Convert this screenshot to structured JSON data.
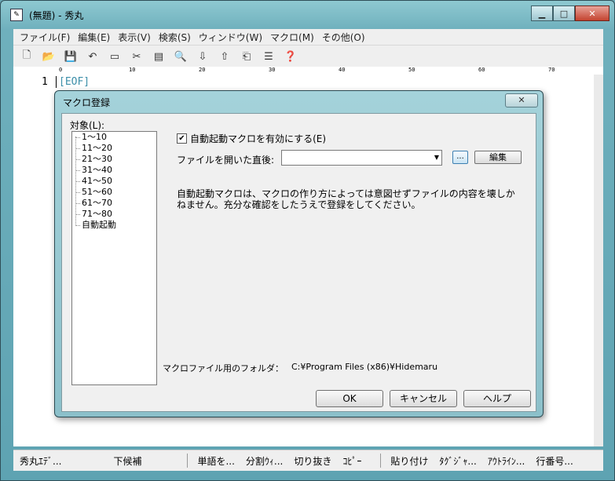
{
  "window": {
    "title": "(無題) - 秀丸",
    "minimize": "▁",
    "maximize": "□",
    "close": "✕"
  },
  "menu": [
    "ファイル(F)",
    "編集(E)",
    "表示(V)",
    "検索(S)",
    "ウィンドウ(W)",
    "マクロ(M)",
    "その他(O)"
  ],
  "toolbar_icons": [
    "new-file-icon",
    "open-folder-icon",
    "save-icon",
    "undo-icon",
    "copy-rect-icon",
    "cut-icon",
    "paste-icon",
    "search-icon",
    "search-down-icon",
    "search-up-icon",
    "tag-jump-icon",
    "split-window-icon",
    "help-icon"
  ],
  "ruler": {
    "marks": [
      "0",
      "10",
      "20",
      "30",
      "40",
      "50",
      "60",
      "70"
    ]
  },
  "editor": {
    "line_number": "1",
    "eof_marker": "[EOF]"
  },
  "status": [
    "秀丸ｴﾃﾞ...",
    "下候補",
    "単語を...",
    "分割ｳｨ...",
    "切り抜き",
    "ｺﾋﾟｰ",
    "貼り付け",
    "ﾀｸﾞｼﾞｬ...",
    "ｱｳﾄﾗｲﾝ...",
    "行番号..."
  ],
  "dialog": {
    "title": "マクロ登録",
    "close": "✕",
    "target_label": "対象(L):",
    "tree": [
      "1～10",
      "11～20",
      "21～30",
      "31～40",
      "41～50",
      "51～60",
      "61～70",
      "71～80",
      "自動起動"
    ],
    "checkbox_label": "自動起動マクロを有効にする(E)",
    "checkbox_checked": true,
    "open_label": "ファイルを開いた直後:",
    "combo_value": "",
    "dots_button": "...",
    "edit_button": "編集",
    "warning": "自動起動マクロは、マクロの作り方によっては意図せずファイルの内容を壊しかねません。充分な確認をしたうえで登録をしてください。",
    "folder_label": "マクロファイル用のフォルダ：",
    "folder_path": "C:¥Program Files (x86)¥Hidemaru",
    "ok": "OK",
    "cancel": "キャンセル",
    "help": "ヘルプ"
  }
}
